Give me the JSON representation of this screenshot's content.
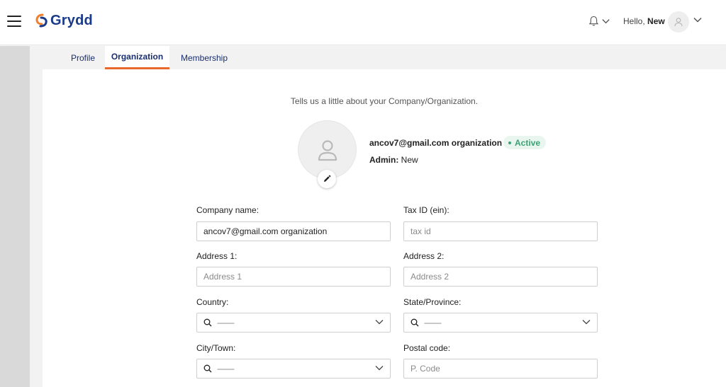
{
  "header": {
    "logo_text": "Grydd",
    "hello_prefix": "Hello,",
    "user_name": "New",
    "colors": {
      "brand_blue": "#1a3a8a",
      "brand_orange": "#f07f2d"
    }
  },
  "tabs": [
    {
      "label": "Profile",
      "active": false
    },
    {
      "label": "Organization",
      "active": true
    },
    {
      "label": "Membership",
      "active": false
    }
  ],
  "intro_text": "Tells us a little about your Company/Organization.",
  "organization": {
    "name": "ancov7@gmail.com organization",
    "status": "Active",
    "admin_label": "Admin:",
    "admin_value": "New"
  },
  "form": {
    "company_name": {
      "label": "Company name:",
      "value": "ancov7@gmail.com organization",
      "placeholder": ""
    },
    "tax_id": {
      "label": "Tax ID (ein):",
      "value": "",
      "placeholder": "tax id"
    },
    "address1": {
      "label": "Address 1:",
      "value": "",
      "placeholder": "Address 1"
    },
    "address2": {
      "label": "Address 2:",
      "value": "",
      "placeholder": "Address 2"
    },
    "country": {
      "label": "Country:",
      "selected": "--------"
    },
    "state": {
      "label": "State/Province:",
      "selected": "--------"
    },
    "city": {
      "label": "City/Town:",
      "selected": "--------"
    },
    "postal_code": {
      "label": "Postal code:",
      "value": "",
      "placeholder": "P. Code"
    }
  },
  "icons": [
    "menu-icon",
    "bell-icon",
    "chevron-down-icon",
    "user-icon",
    "pencil-icon",
    "search-icon"
  ],
  "colors": {
    "active_tab_underline": "#e8672b",
    "active_badge_bg": "#e9f6ef",
    "active_badge_text": "#3aa372"
  }
}
